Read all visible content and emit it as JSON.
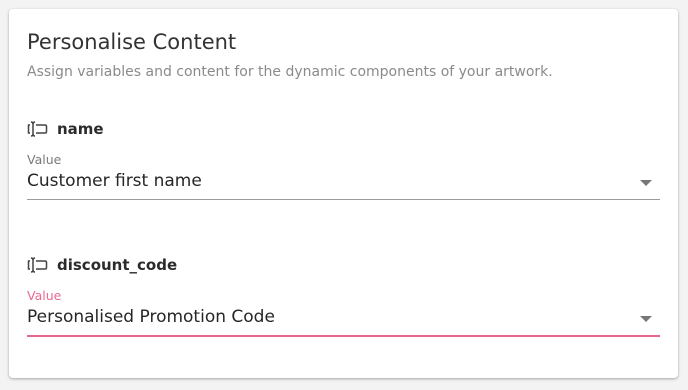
{
  "panel": {
    "title": "Personalise Content",
    "subtitle": "Assign variables and content for the dynamic components of your artwork."
  },
  "variables": [
    {
      "name": "name",
      "icon": "text-cursor-icon",
      "field_label": "Value",
      "selected_value": "Customer first name",
      "focused": false
    },
    {
      "name": "discount_code",
      "icon": "text-cursor-icon",
      "field_label": "Value",
      "selected_value": "Personalised Promotion Code",
      "focused": true
    }
  ],
  "colors": {
    "accent": "#e9688e",
    "text": "#262626",
    "muted": "#8a8a8a",
    "underline": "#9b9b9b"
  }
}
